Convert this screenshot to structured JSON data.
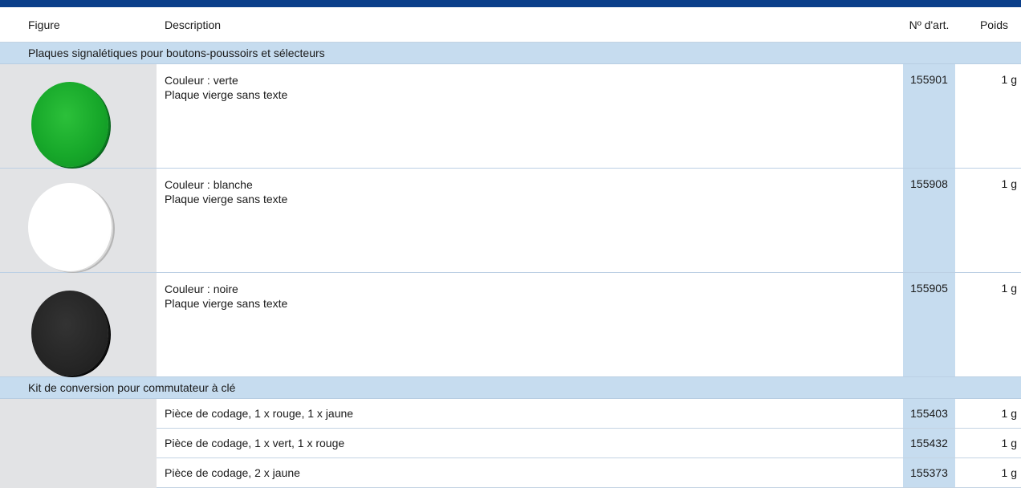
{
  "header": {
    "figure": "Figure",
    "description": "Description",
    "article_no": "Nº d'art.",
    "weight": "Poids"
  },
  "colors": {
    "top_bar": "#0b3f8a",
    "section_bg": "#c6dcef",
    "figure_bg": "#e2e3e5"
  },
  "sections": [
    {
      "title": "Plaques signalétiques pour boutons-poussoirs et sélecteurs",
      "products": [
        {
          "color_name": "green",
          "line1": "Couleur : verte",
          "line2": "Plaque vierge sans texte",
          "article": "155901",
          "weight": "1 g"
        },
        {
          "color_name": "white",
          "line1": "Couleur : blanche",
          "line2": "Plaque vierge sans texte",
          "article": "155908",
          "weight": "1 g"
        },
        {
          "color_name": "black",
          "line1": "Couleur : noire",
          "line2": "Plaque vierge sans texte",
          "article": "155905",
          "weight": "1 g"
        }
      ]
    },
    {
      "title": "Kit de conversion pour commutateur à clé",
      "items": [
        {
          "description": "Pièce de codage, 1 x rouge, 1 x jaune",
          "article": "155403",
          "weight": "1 g"
        },
        {
          "description": "Pièce de codage, 1 x vert, 1 x rouge",
          "article": "155432",
          "weight": "1 g"
        },
        {
          "description": "Pièce de codage, 2 x jaune",
          "article": "155373",
          "weight": "1 g"
        }
      ]
    }
  ]
}
